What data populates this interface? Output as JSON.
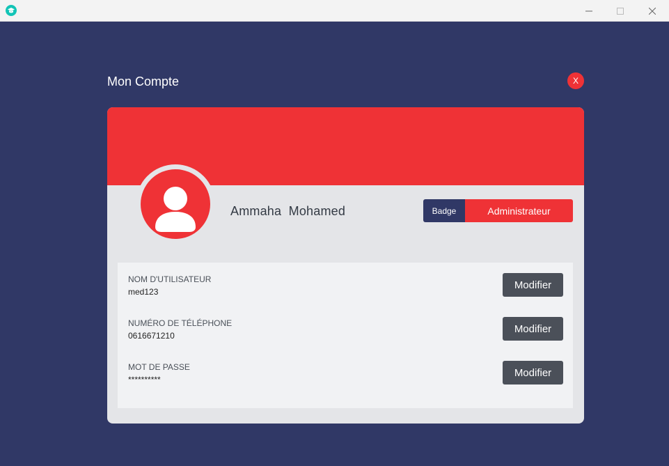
{
  "window": {
    "icon": "graduation-cap-icon",
    "controls": {
      "minimize": "minimize-icon",
      "maximize": "maximize-icon",
      "close": "close-icon"
    }
  },
  "page": {
    "title": "Mon Compte",
    "close_label": "X"
  },
  "profile": {
    "name": "Ammaha  Mohamed",
    "badge_label": "Badge",
    "badge_value": "Administrateur"
  },
  "fields": [
    {
      "label": "NOM D'UTILISATEUR",
      "value": "med123",
      "button": "Modifier"
    },
    {
      "label": "NUMÉRO DE TÉLÉPHONE",
      "value": "0616671210",
      "button": "Modifier"
    },
    {
      "label": "MOT DE PASSE",
      "value": "**********",
      "button": "Modifier"
    }
  ],
  "colors": {
    "background": "#303866",
    "accent": "#ef3236",
    "card": "#e4e5e8",
    "panel": "#f1f2f4",
    "button": "#4b5059"
  }
}
